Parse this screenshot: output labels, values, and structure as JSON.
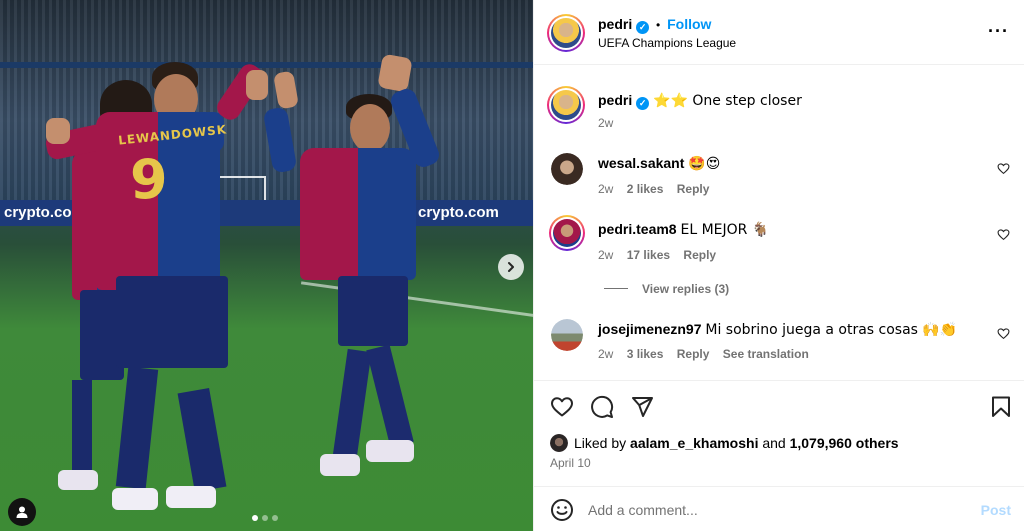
{
  "media": {
    "board_texts": [
      "crypto.com",
      "crypto.com"
    ],
    "jersey_name": "LEWANDOWSK",
    "jersey_number": "9",
    "carousel_dots": 3,
    "active_dot": 0
  },
  "header": {
    "username": "pedri",
    "separator": "•",
    "follow_label": "Follow",
    "location": "UEFA Champions League"
  },
  "caption": {
    "username": "pedri",
    "text": "⭐⭐ One step closer",
    "time": "2w"
  },
  "comments": [
    {
      "username": "wesal.sakant",
      "text": "🤩😍",
      "time": "2w",
      "likes": "2 likes",
      "reply": "Reply",
      "translate": ""
    },
    {
      "username": "pedri.team8",
      "text": "EL MEJOR 🐐",
      "time": "2w",
      "likes": "17 likes",
      "reply": "Reply",
      "translate": ""
    },
    {
      "username": "josejimenezn97",
      "text": "Mi sobrino juega a otras cosas 🙌👏",
      "time": "2w",
      "likes": "3 likes",
      "reply": "Reply",
      "translate": "See translation"
    }
  ],
  "view_replies": "View replies (3)",
  "likes": {
    "prefix": "Liked by",
    "user": "aalam_e_khamoshi",
    "connector": "and",
    "count": "1,079,960 others"
  },
  "date": "April 10",
  "add_comment": {
    "placeholder": "Add a comment...",
    "post_label": "Post"
  },
  "icons": {
    "like": "heart-icon",
    "comment": "comment-icon",
    "share": "send-icon",
    "save": "bookmark-icon",
    "more": "more-options-icon",
    "emoji": "emoji-icon",
    "next": "chevron-right-icon",
    "user_tag": "user-tag-icon"
  },
  "colors": {
    "accent": "#0095f6",
    "muted": "#737373",
    "post_disabled": "#b3dbff"
  }
}
